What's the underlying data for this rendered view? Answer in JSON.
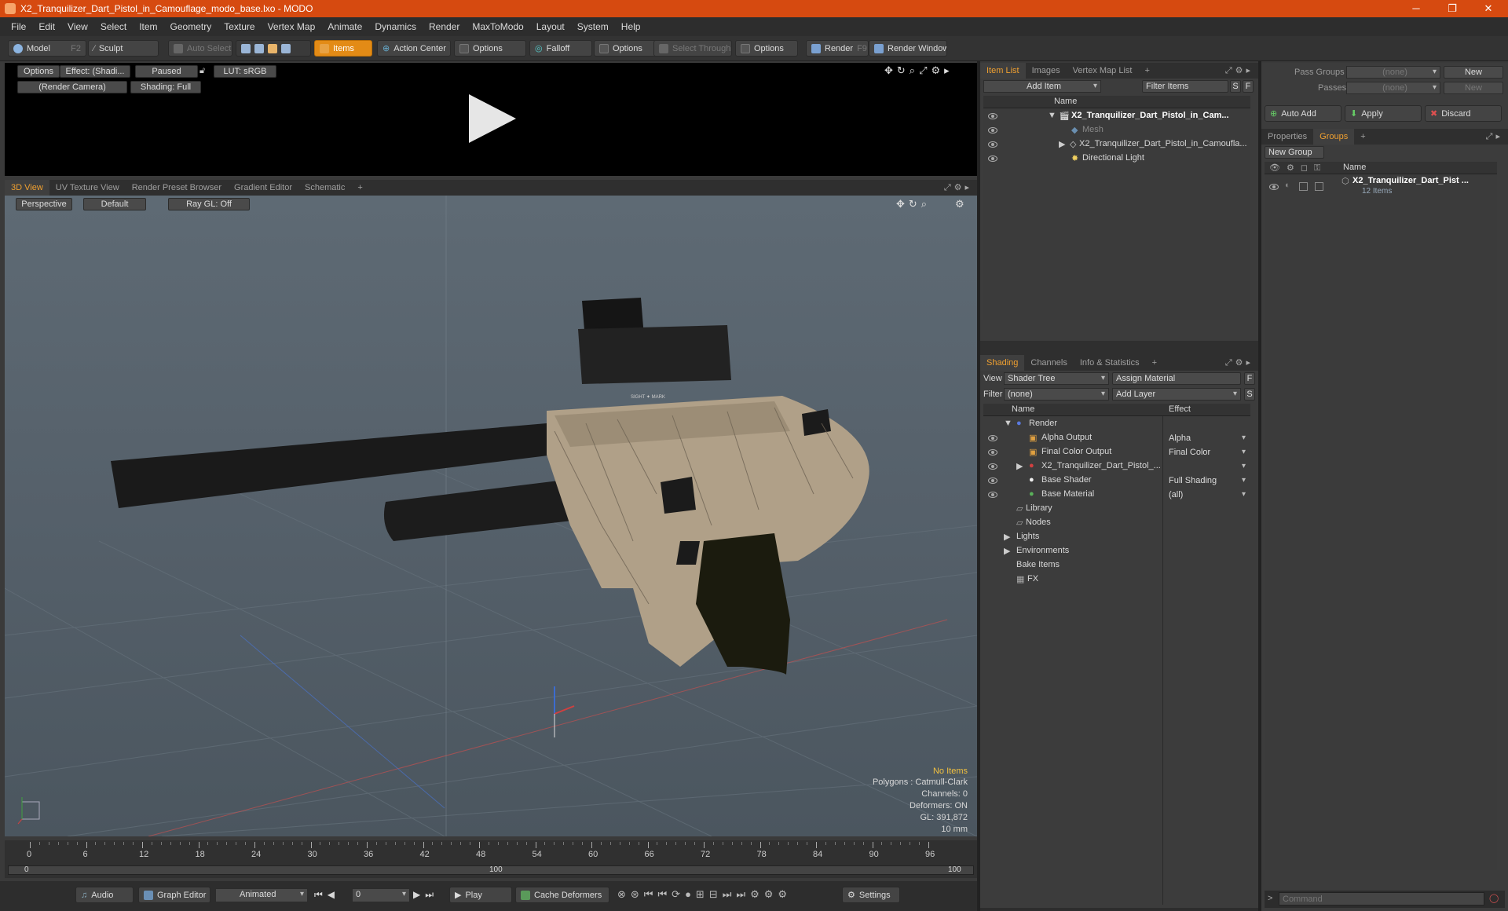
{
  "window": {
    "title": "X2_Tranquilizer_Dart_Pistol_in_Camouflage_modo_base.lxo - MODO",
    "minimize": "─",
    "maximize": "❐",
    "close": "✕"
  },
  "menu": [
    "File",
    "Edit",
    "View",
    "Select",
    "Item",
    "Geometry",
    "Texture",
    "Vertex Map",
    "Animate",
    "Dynamics",
    "Render",
    "MaxToModo",
    "Layout",
    "System",
    "Help"
  ],
  "toolbar": {
    "model": "Model",
    "model_key": "F2",
    "sculpt": "Sculpt",
    "auto_select": "Auto Select",
    "items": "Items",
    "action_center": "Action Center",
    "options1": "Options",
    "falloff": "Falloff",
    "options2": "Options",
    "select_through": "Select Through",
    "options3": "Options",
    "render": "Render",
    "render_key": "F9",
    "render_window": "Render Window"
  },
  "preview": {
    "options": "Options",
    "effect": "Effect: (Shadi...",
    "paused": "Paused",
    "lut": "LUT: sRGB",
    "camera": "(Render Camera)",
    "shading": "Shading: Full"
  },
  "viewport_tabs": [
    "3D View",
    "UV Texture View",
    "Render Preset Browser",
    "Gradient Editor",
    "Schematic",
    "+"
  ],
  "viewport": {
    "perspective": "Perspective",
    "default": "Default",
    "raygl": "Ray GL: Off",
    "status": {
      "no_items": "No Items",
      "polygons": "Polygons : Catmull-Clark",
      "channels": "Channels: 0",
      "deformers": "Deformers: ON",
      "gl": "GL: 391,872",
      "scale": "10 mm"
    },
    "scope_text": "SIGHT ✦ MARK"
  },
  "timeline": {
    "ticks": [
      "0",
      "6",
      "12",
      "18",
      "24",
      "30",
      "36",
      "42",
      "48",
      "54",
      "60",
      "66",
      "72",
      "78",
      "84",
      "90",
      "96"
    ],
    "range_start": "0",
    "range_mid": "100",
    "range_end": "100"
  },
  "bottom": {
    "audio": "Audio",
    "graph_editor": "Graph Editor",
    "animated": "Animated",
    "frame": "0",
    "play": "Play",
    "cache_deformers": "Cache Deformers",
    "settings": "Settings"
  },
  "itemlist": {
    "tabs": [
      "Item List",
      "Images",
      "Vertex Map List",
      "+"
    ],
    "add_item": "Add Item",
    "filter_items": "Filter Items",
    "s": "S",
    "f": "F",
    "col_name": "Name",
    "rows": [
      {
        "name": "X2_Tranquilizer_Dart_Pistol_in_Cam..."
      },
      {
        "name": "Mesh"
      },
      {
        "name": "X2_Tranquilizer_Dart_Pistol_in_Camoufla..."
      },
      {
        "name": "Directional Light"
      }
    ]
  },
  "shading": {
    "tabs": [
      "Shading",
      "Channels",
      "Info & Statistics",
      "+"
    ],
    "view_label": "View",
    "view_value": "Shader Tree",
    "assign_material": "Assign Material",
    "filter_label": "Filter",
    "filter_value": "(none)",
    "add_layer": "Add Layer",
    "f": "F",
    "s": "S",
    "col_name": "Name",
    "col_effect": "Effect",
    "rows": [
      {
        "name": "Render",
        "effect": ""
      },
      {
        "name": "Alpha Output",
        "effect": "Alpha"
      },
      {
        "name": "Final Color Output",
        "effect": "Final Color"
      },
      {
        "name": "X2_Tranquilizer_Dart_Pistol_...",
        "effect": ""
      },
      {
        "name": "Base Shader",
        "effect": "Full Shading"
      },
      {
        "name": "Base Material",
        "effect": "(all)"
      },
      {
        "name": "Library",
        "effect": ""
      },
      {
        "name": "Nodes",
        "effect": ""
      },
      {
        "name": "Lights",
        "effect": ""
      },
      {
        "name": "Environments",
        "effect": ""
      },
      {
        "name": "Bake Items",
        "effect": ""
      },
      {
        "name": "FX",
        "effect": ""
      }
    ]
  },
  "groups": {
    "pass_groups_label": "Pass Groups",
    "pass_groups_value": "(none)",
    "passes_label": "Passes",
    "passes_value": "(none)",
    "new": "New",
    "new2": "New",
    "auto_add": "Auto Add",
    "apply": "Apply",
    "discard": "Discard",
    "tabs": [
      "Properties",
      "Groups",
      "+"
    ],
    "new_group": "New Group",
    "col_name": "Name",
    "group_name": "X2_Tranquilizer_Dart_Pist ...",
    "group_count": "12 Items",
    "command_placeholder": "Command"
  }
}
